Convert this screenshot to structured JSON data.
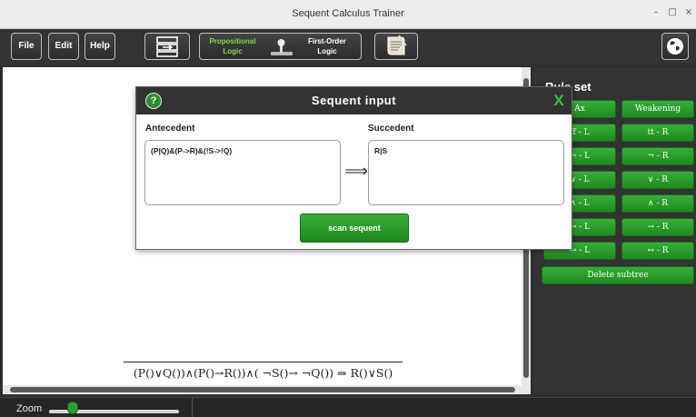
{
  "window": {
    "title": "Sequent Calculus Trainer",
    "minimize": "–",
    "maximize": "□",
    "close": "×"
  },
  "toolbar": {
    "file": "File",
    "edit": "Edit",
    "help": "Help",
    "logic": {
      "propositional": [
        "Propositional",
        "Logic"
      ],
      "first_order": [
        "First-Order",
        "Logic"
      ],
      "selected": "Propositional Logic"
    }
  },
  "colors": {
    "accent_green": "#2ca02c",
    "dark_bg": "#333333",
    "canvas_bg": "#ffffff"
  },
  "proof": {
    "formula": "(P()∨Q())∧(P()→R())∧( ¬S()→ ¬Q()) ⇒ R()∨S()"
  },
  "rules": {
    "title": "Rule set",
    "buttons": [
      [
        "Ax",
        "Weakening"
      ],
      [
        "ff - L",
        "tt - R"
      ],
      [
        "¬ - L",
        "¬ - R"
      ],
      [
        "∨ - L",
        "∨ - R"
      ],
      [
        "∧ - L",
        "∧ - R"
      ],
      [
        "→ - L",
        "→ - R"
      ],
      [
        "↔ - L",
        "↔ - R"
      ]
    ],
    "delete": "Delete subtree"
  },
  "dialog": {
    "title": "Sequent input",
    "help_glyph": "?",
    "close_glyph": "X",
    "antecedent_label": "Antecedent",
    "succedent_label": "Succedent",
    "antecedent_value": "(P|Q)&(P->R)&(!S->!Q)",
    "succedent_value": "R|S",
    "arrow": "⟹",
    "scan_button": "scan sequent"
  },
  "status": {
    "zoom_label": "Zoom",
    "zoom_level": 0.18
  },
  "icons": {
    "globe": "globe-icon",
    "tree": "proof-tree-icon",
    "scroll": "scroll-icon",
    "help": "help-icon",
    "close": "close-icon"
  }
}
